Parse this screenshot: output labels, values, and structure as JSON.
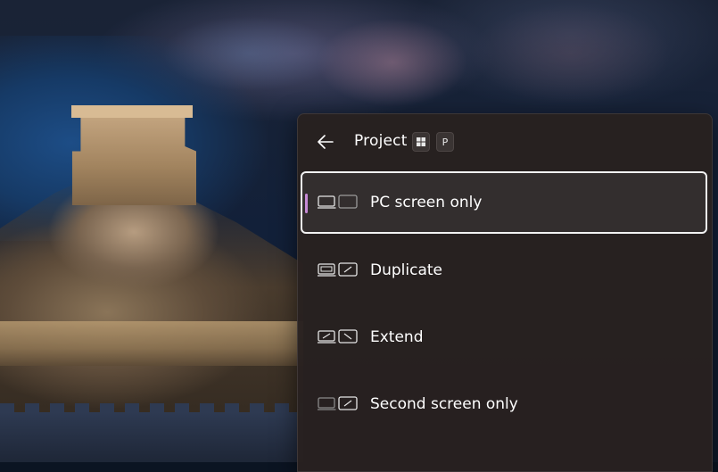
{
  "flyout": {
    "title": "Project",
    "shortcut_keys": [
      {
        "icon": "windows-logo-icon"
      },
      {
        "key": "P"
      }
    ],
    "options": [
      {
        "label": "PC screen only",
        "icon": "pc-screen-only-icon",
        "selected": true
      },
      {
        "label": "Duplicate",
        "icon": "duplicate-icon",
        "selected": false
      },
      {
        "label": "Extend",
        "icon": "extend-icon",
        "selected": false
      },
      {
        "label": "Second screen only",
        "icon": "second-screen-only-icon",
        "selected": false
      }
    ]
  },
  "colors": {
    "flyout_bg": "#282120",
    "text": "#ffffff",
    "selection_accent": "#c78ad6",
    "selection_border": "#f2f2f2"
  }
}
